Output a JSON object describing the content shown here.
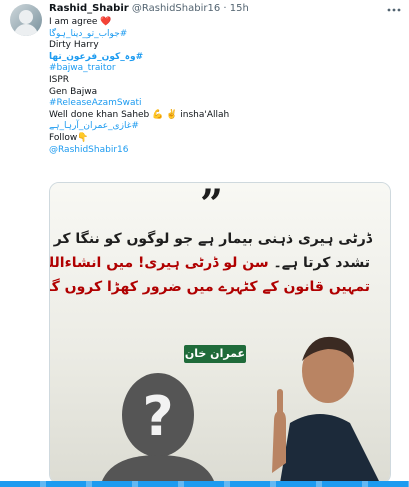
{
  "author": {
    "name": "Rashid_Shabir",
    "handle": "@RashidShabir16",
    "separator": "·",
    "time": "15h"
  },
  "more_icon": "more-horizontal-icon",
  "tweet_lines": [
    {
      "text": "I am agree ❤️",
      "kind": "text"
    },
    {
      "text": "#جواب_تو_دینا_ہوگا",
      "kind": "hashtag"
    },
    {
      "text": "Dirty Harry",
      "kind": "text"
    },
    {
      "text": "#وہ_کون_فرعون_تھا",
      "kind": "hashtag-bold"
    },
    {
      "text": "#bajwa_traitor",
      "kind": "hashtag"
    },
    {
      "text": "ISPR",
      "kind": "text"
    },
    {
      "text": "Gen Bajwa",
      "kind": "text"
    },
    {
      "text": "#ReleaseAzamSwati",
      "kind": "hashtag"
    },
    {
      "text": "Well done khan Saheb 💪 ✌️ insha'Allah",
      "kind": "text"
    },
    {
      "text": "#غازی_عمران_آرہا_ہے",
      "kind": "hashtag"
    },
    {
      "text": "Follow👇",
      "kind": "text"
    },
    {
      "text": "@RashidShabir16",
      "kind": "mention"
    }
  ],
  "card": {
    "quote_mark": "”",
    "line1": "ڈرٹی ہیری ذہنی بیمار ہے جو لوگوں کو ننگا کر کے",
    "line2_black": "تشدد کرتا ہے۔",
    "line2_red": " سن لو ڈرٹی ہیری! میں انشاءاللہ",
    "line3": "تمہیں قانون کے کٹہرے میں ضرور کھڑا کروں گا",
    "badge": "عمران خان"
  },
  "colors": {
    "link": "#1d9bf0",
    "badge_green": "#1f6b3a",
    "accent_red": "#b00000"
  }
}
